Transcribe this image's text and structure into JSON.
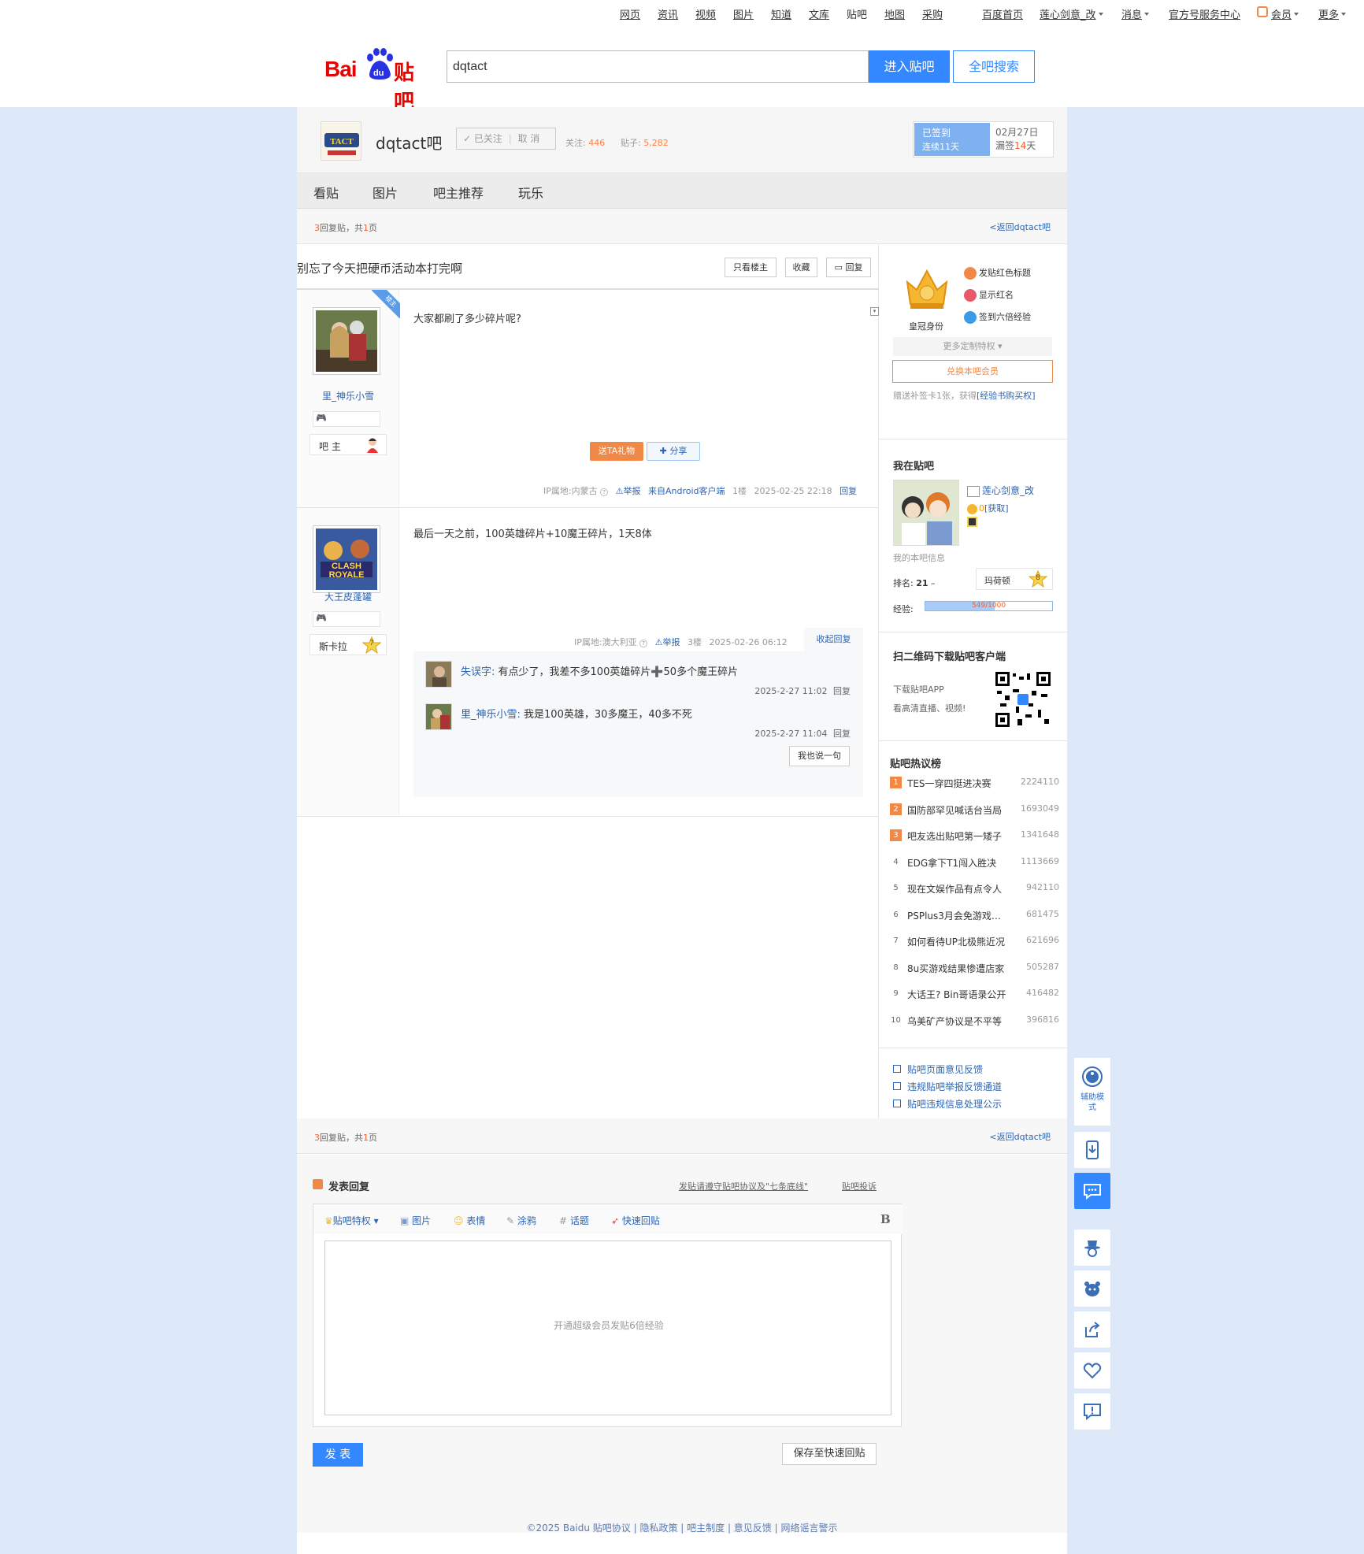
{
  "topbar": {
    "left_links": [
      "网页",
      "资讯",
      "视频",
      "图片",
      "知道",
      "文库",
      "贴吧",
      "地图",
      "采购"
    ],
    "right_links": [
      "百度首页",
      "莲心剑意_改",
      "消息",
      "官方号服务中心",
      "会员",
      "更多"
    ]
  },
  "search": {
    "value": "dqtact",
    "enter_label": "进入贴吧",
    "all_label": "全吧搜索"
  },
  "logo": {
    "bai": "Bai",
    "du": "du",
    "tieba": "贴吧"
  },
  "forum": {
    "name": "dqtact吧",
    "follow_label": "已关注",
    "cancel_label": "取 消",
    "followers_label": "关注:",
    "followers": "446",
    "posts_label": "贴子:",
    "posts": "5,282",
    "signed_label": "已签到",
    "streak": "连续11天",
    "date": "02月27日",
    "missed_prefix": "漏签",
    "missed_days": "14",
    "missed_suffix": "天"
  },
  "tabs": [
    "看贴",
    "图片",
    "吧主推荐",
    "玩乐"
  ],
  "pager": {
    "replies": "3",
    "replies_suffix": "回复贴，共",
    "pages": "1",
    "pages_suffix": "页",
    "back": "<返回dqtact吧"
  },
  "thread": {
    "title": "别忘了今天把硬币活动本打完啊",
    "buttons": [
      "只看楼主",
      "收藏",
      "回复"
    ]
  },
  "posts": [
    {
      "user": "里_神乐小雪",
      "rank": "吧 主",
      "lz_tag": "楼主",
      "text": "大家都刷了多少碎片呢?",
      "gift": "送TA礼物",
      "share": "分享",
      "ip": "IP属地:内蒙古",
      "report": "举报",
      "client": "来自Android客户端",
      "floor": "1楼",
      "time": "2025-02-25 22:18",
      "reply": "回复"
    },
    {
      "user": "大王皮蓬罐",
      "rank": "斯卡拉",
      "level": "7",
      "text": "最后一天之前，100英雄碎片+10魔王碎片，1天8体",
      "ip": "IP属地:澳大利亚",
      "report": "举报",
      "floor": "3楼",
      "time": "2025-02-26 06:12",
      "collapse": "收起回复",
      "replies": [
        {
          "user": "失误字:",
          "text": "有点少了，我差不多100英雄碎片➕50多个魔王碎片",
          "time": "2025-2-27 11:02",
          "reply": "回复"
        },
        {
          "user": "里_神乐小雪:",
          "text": "我是100英雄，30多魔王，40多不死",
          "time": "2025-2-27 11:04",
          "reply": "回复"
        }
      ],
      "say": "我也说一句"
    }
  ],
  "member": {
    "crown_label": "皇冠身份",
    "perks": [
      "发贴红色标题",
      "显示红名",
      "签到六倍经验"
    ],
    "more": "更多定制特权",
    "exchange": "兑换本吧会员",
    "gift_text": "赠送补签卡1张，获得",
    "gift_link": "[经验书购买权]"
  },
  "me": {
    "title": "我在贴吧",
    "name": "莲心剑意_改",
    "coins": "0",
    "get": "[获取]",
    "info_label": "我的本吧信息",
    "rank_label": "排名:",
    "rank": "21",
    "rank_trend": "–",
    "level_name": "玛荷顿",
    "level": "8",
    "exp_label": "经验:",
    "exp": "549/1000",
    "exp_fraction": 0.549
  },
  "qr": {
    "title": "扫二维码下载贴吧客户端",
    "line1": "下载贴吧APP",
    "line2": "看高清直播、视频!"
  },
  "hot": {
    "title": "贴吧热议榜",
    "items": [
      {
        "rank": "1",
        "title": "TES一穿四挺进决赛",
        "count": "2224110"
      },
      {
        "rank": "2",
        "title": "国防部罕见喊话台当局",
        "count": "1693049"
      },
      {
        "rank": "3",
        "title": "吧友选出贴吧第一矮子",
        "count": "1341648"
      },
      {
        "rank": "4",
        "title": "EDG拿下T1闯入胜决",
        "count": "1113669"
      },
      {
        "rank": "5",
        "title": "现在文娱作品有点令人",
        "count": "942110"
      },
      {
        "rank": "6",
        "title": "PSPlus3月会免游戏公布",
        "count": "681475"
      },
      {
        "rank": "7",
        "title": "如何看待UP北极熊近况",
        "count": "621696"
      },
      {
        "rank": "8",
        "title": "8u买游戏结果惨遭店家",
        "count": "505287"
      },
      {
        "rank": "9",
        "title": "大话王? Bin哥语录公开",
        "count": "416482"
      },
      {
        "rank": "10",
        "title": "乌美矿产协议是不平等",
        "count": "396816"
      }
    ]
  },
  "feedback": [
    "贴吧页面意见反馈",
    "违规贴吧举报反馈通道",
    "贴吧违规信息处理公示"
  ],
  "editor": {
    "title": "发表回复",
    "notice": "发贴请遵守贴吧协议及\"七条底线\"",
    "complain": "贴吧投诉",
    "tools": [
      "贴吧特权",
      "图片",
      "表情",
      "涂鸦",
      "话题",
      "快速回贴"
    ],
    "bold": "B",
    "placeholder": "开通超级会员发贴6倍经验",
    "post": "发 表",
    "save": "保存至快速回贴"
  },
  "footer": {
    "text": "©2025 Baidu 贴吧协议 | 隐私政策 | 吧主制度 | 意见反馈 | 网络谣言警示"
  },
  "side": {
    "assist": "辅助模式"
  },
  "colors": {
    "accent": "#3388ff",
    "link": "#2d64b3",
    "orange": "#f08948",
    "bg": "#dde9f9"
  }
}
